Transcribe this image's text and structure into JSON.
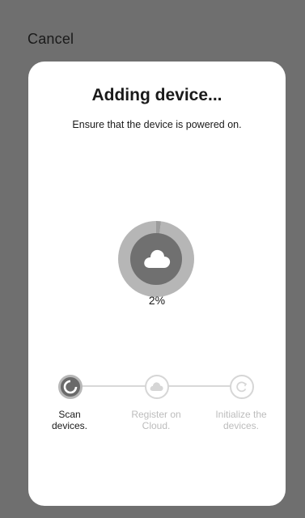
{
  "header": {
    "cancel_label": "Cancel"
  },
  "dialog": {
    "title": "Adding device...",
    "subtitle": "Ensure that the device is powered on."
  },
  "progress": {
    "value": 0.02,
    "label": "2%",
    "icon": "cloud-icon"
  },
  "steps": [
    {
      "label_line1": "Scan",
      "label_line2": "devices.",
      "state": "active",
      "icon": "scan-icon"
    },
    {
      "label_line1": "Register on",
      "label_line2": "Cloud.",
      "state": "inactive",
      "icon": "cloud-icon"
    },
    {
      "label_line1": "Initialize the",
      "label_line2": "devices.",
      "state": "inactive",
      "icon": "refresh-icon"
    }
  ],
  "colors": {
    "backdrop": "#6f6f6f",
    "card": "#ffffff",
    "active_step": "#6a6a6a",
    "inactive_step": "#d6d6d6"
  }
}
